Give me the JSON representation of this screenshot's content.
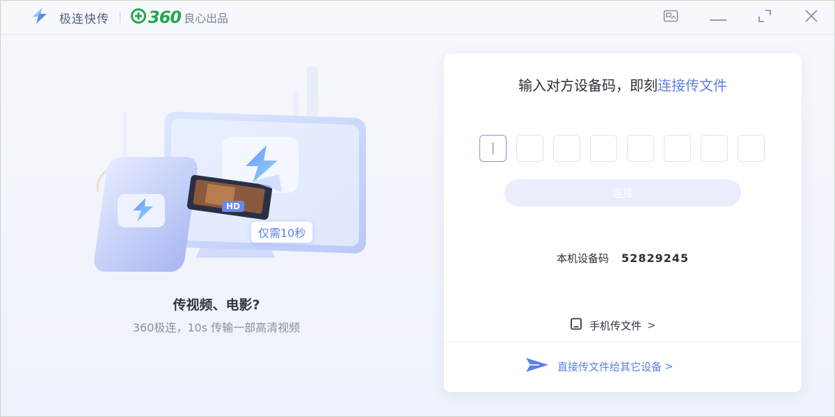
{
  "titlebar": {
    "app_name": "极连快传",
    "logo_num": "360",
    "tagline": "良心出品",
    "icons": [
      "screenshot-icon",
      "minimize-icon",
      "restore-icon",
      "close-icon"
    ]
  },
  "illustration": {
    "badge_hd": "HD",
    "badge_speed": "仅需10秒"
  },
  "left_caption": {
    "title": "传视频、电影?",
    "subtitle": "360极连，10s 传输一部高清视频"
  },
  "connect_card": {
    "title_prefix": "输入对方设备码，即刻",
    "title_accent": "连接传文件",
    "code_length": 8,
    "connect_button": "连接",
    "local_code_label": "本机设备码",
    "local_code_value": "52829245",
    "phone_link": "手机传文件",
    "phone_chevron": ">",
    "direct_link": "直接传文件给其它设备",
    "direct_chevron": ">"
  },
  "colors": {
    "accent": "#5a7fe6",
    "brand_green": "#1fa84a",
    "button_disabled_bg": "#eaedfc"
  }
}
